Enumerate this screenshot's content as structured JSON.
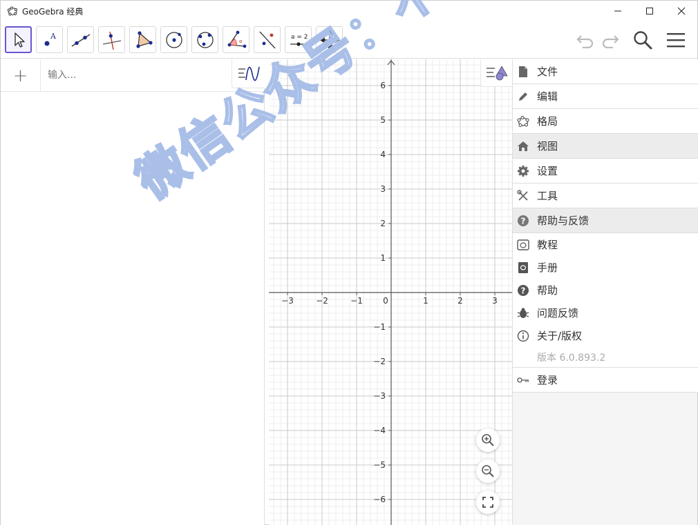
{
  "window": {
    "title": "GeoGebra 经典",
    "controls": [
      "minimize-icon",
      "maximize-icon",
      "close-icon"
    ]
  },
  "toolbar": {
    "tools": [
      {
        "name": "move-tool",
        "icon": "arrow-cursor-icon",
        "selected": true
      },
      {
        "name": "point-tool",
        "icon": "point-icon"
      },
      {
        "name": "line-tool",
        "icon": "line-icon"
      },
      {
        "name": "perpendicular-line-tool",
        "icon": "perpendicular-line-icon"
      },
      {
        "name": "polygon-tool",
        "icon": "polygon-icon"
      },
      {
        "name": "circle-center-point-tool",
        "icon": "circle-icon"
      },
      {
        "name": "ellipse-tool",
        "icon": "ellipse-icon"
      },
      {
        "name": "angle-tool",
        "icon": "angle-icon"
      },
      {
        "name": "reflect-tool",
        "icon": "reflect-line-icon"
      },
      {
        "name": "slider-tool",
        "icon": "slider-icon",
        "label": "a = 2"
      },
      {
        "name": "move-graphics-view-tool",
        "icon": "move-cross-icon"
      }
    ],
    "right": [
      "undo-icon",
      "redo-icon",
      "search-icon",
      "hamburger-menu-icon"
    ]
  },
  "algebra": {
    "add_label": "+",
    "input_placeholder": "输入..."
  },
  "graphics": {
    "x_ticks": [
      "−3",
      "−2",
      "−1",
      "0",
      "1",
      "2",
      "3"
    ],
    "y_ticks_pos": [
      "6",
      "5",
      "4",
      "3",
      "2",
      "1"
    ],
    "y_ticks_neg": [
      "−1",
      "−2",
      "−3",
      "−4",
      "−5",
      "−6"
    ],
    "grid": true,
    "zoom_buttons": [
      "zoom-in-icon",
      "zoom-out-icon",
      "fullscreen-icon"
    ]
  },
  "menu": {
    "items": [
      {
        "label": "文件",
        "icon": "file-icon"
      },
      {
        "label": "编辑",
        "icon": "pencil-icon"
      },
      {
        "label": "格局",
        "icon": "perspectives-icon"
      },
      {
        "label": "视图",
        "icon": "home-icon"
      },
      {
        "label": "设置",
        "icon": "gear-icon"
      },
      {
        "label": "工具",
        "icon": "tools-icon"
      },
      {
        "label": "帮助与反馈",
        "icon": "help-circle-icon"
      }
    ],
    "help_sub": [
      {
        "label": "教程",
        "icon": "tutorial-icon"
      },
      {
        "label": "手册",
        "icon": "manual-icon"
      },
      {
        "label": "帮助",
        "icon": "help-icon"
      },
      {
        "label": "问题反馈",
        "icon": "bug-icon"
      },
      {
        "label": "关于/版权",
        "icon": "info-icon"
      }
    ],
    "version": "版本 6.0.893.2",
    "sign_in": {
      "label": "登录",
      "icon": "key-icon"
    }
  },
  "watermark": "微信公众号：不米路资源库",
  "colors": {
    "accent": "#6557d2",
    "point": "#1565c0",
    "axis": "#555555",
    "grid_major": "#c8c8c8",
    "grid_minor": "#ececec",
    "watermark": "#a9bfe8"
  }
}
